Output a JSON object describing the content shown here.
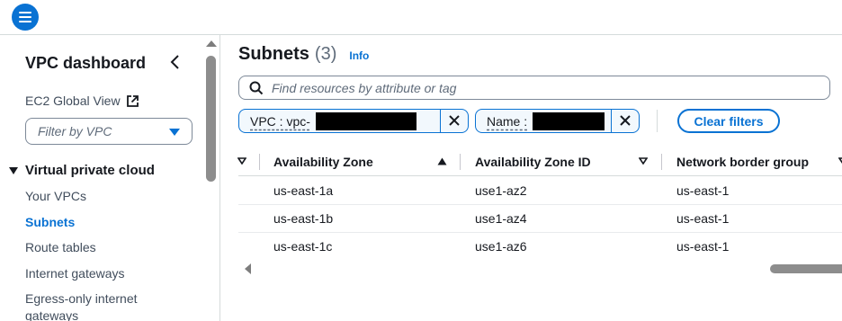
{
  "sidebar": {
    "title": "VPC dashboard",
    "ec2_global_view": "EC2 Global View",
    "filter_placeholder": "Filter by VPC",
    "section_title": "Virtual private cloud",
    "items": [
      {
        "label": "Your VPCs",
        "active": false
      },
      {
        "label": "Subnets",
        "active": true
      },
      {
        "label": "Route tables",
        "active": false
      },
      {
        "label": "Internet gateways",
        "active": false
      },
      {
        "label": "Egress-only internet",
        "active": false
      },
      {
        "label": "gateways",
        "active": false
      }
    ]
  },
  "main": {
    "title": "Subnets",
    "count": "(3)",
    "info_link": "Info",
    "search_placeholder": "Find resources by attribute or tag",
    "filters": [
      {
        "label": "VPC : vpc-",
        "redacted": true
      },
      {
        "label": "Name : ",
        "redacted": true
      }
    ],
    "clear_filters": "Clear filters",
    "table": {
      "columns": [
        "Availability Zone",
        "Availability Zone ID",
        "Network border group"
      ],
      "sorted_column": "Availability Zone",
      "rows": [
        [
          "us-east-1a",
          "use1-az2",
          "us-east-1"
        ],
        [
          "us-east-1b",
          "use1-az4",
          "us-east-1"
        ],
        [
          "us-east-1c",
          "use1-az6",
          "us-east-1"
        ]
      ]
    }
  },
  "icons": {
    "menu": "hamburger-menu-icon",
    "collapse": "chevron-left-icon",
    "external": "external-link-icon",
    "search": "search-icon",
    "remove": "close-icon",
    "sort_asc": "sort-ascending-icon",
    "sort": "sort-descending-icon"
  },
  "colors": {
    "accent": "#0972d3",
    "text": "#16191f",
    "muted": "#5f6b7a",
    "border": "#d5dbdb"
  }
}
